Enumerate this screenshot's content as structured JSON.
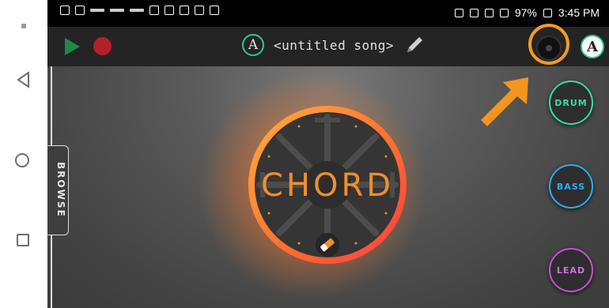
{
  "status_bar": {
    "right_text": "97%",
    "time": "3:45 PM"
  },
  "toolbar": {
    "song_title": "<untitled song>",
    "logo_letter": "A",
    "account_letter": "A"
  },
  "main": {
    "browse_label": "BROWSE",
    "chord_label": "CHORD",
    "instruments": [
      {
        "label": "DRUM",
        "color": "#2fe0a5"
      },
      {
        "label": "BASS",
        "color": "#2aaef0"
      },
      {
        "label": "LEAD",
        "color": "#c850d6"
      }
    ]
  },
  "colors": {
    "accent_orange": "#f08f2a",
    "play_green": "#1e8a4a",
    "record_red": "#b3202a",
    "toolbar_bg": "#242424"
  },
  "icons": [
    "back-icon",
    "home-icon",
    "recents-icon",
    "play-icon",
    "record-icon",
    "logo-icon",
    "edit-pencil-icon",
    "avatar-icon",
    "eraser-icon",
    "arrow-pointer-icon"
  ]
}
